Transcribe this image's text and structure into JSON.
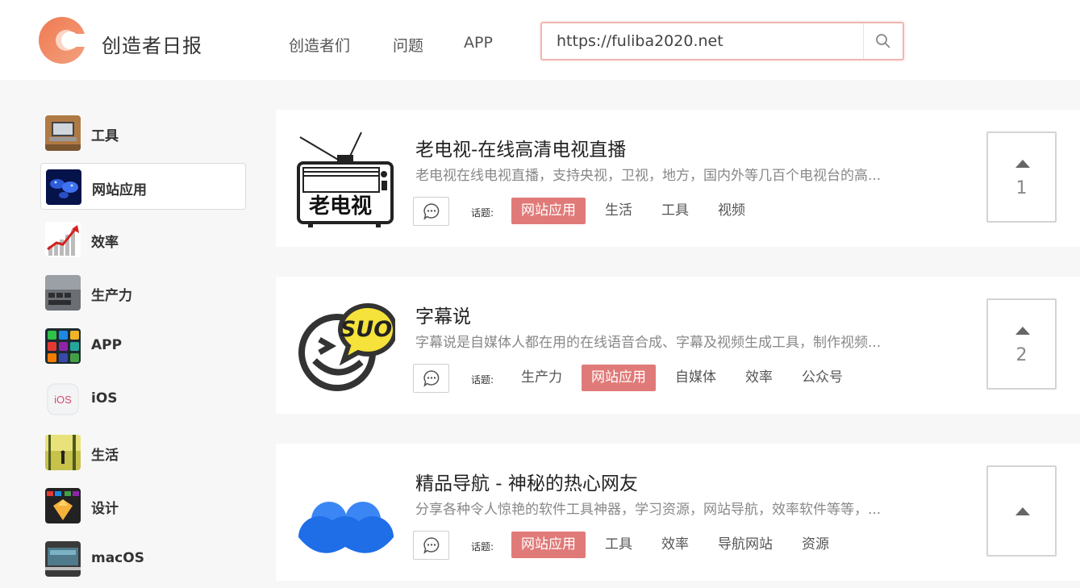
{
  "header": {
    "brand": "创造者日报",
    "nav": [
      "创造者们",
      "问题",
      "APP"
    ],
    "search_value": "https://fuliba2020.net",
    "logo_icon": "c-logo-icon",
    "accent_color": "#e07a78"
  },
  "sidebar": {
    "items": [
      {
        "label": "工具",
        "icon": "laptop-desk-icon"
      },
      {
        "label": "网站应用",
        "icon": "world-map-icon",
        "active": true
      },
      {
        "label": "效率",
        "icon": "growth-chart-icon"
      },
      {
        "label": "生产力",
        "icon": "keyboard-icon"
      },
      {
        "label": "APP",
        "icon": "app-grid-icon"
      },
      {
        "label": "iOS",
        "icon": "ios-icon"
      },
      {
        "label": "生活",
        "icon": "forest-walk-icon"
      },
      {
        "label": "设计",
        "icon": "sketch-icon"
      },
      {
        "label": "macOS",
        "icon": "macbook-icon"
      }
    ]
  },
  "topic_label": "话题:",
  "cards": [
    {
      "title": "老电视-在线高清电视直播",
      "description": "老电视在线电视直播，支持央视，卫视，地方，国内外等几百个电视台的高...",
      "thumb_text": "老电视",
      "tags": [
        "网站应用",
        "生活",
        "工具",
        "视频"
      ],
      "hot_tag": 0,
      "votes": "1"
    },
    {
      "title": "字幕说",
      "description": "字幕说是自媒体人都在用的在线语音合成、字幕及视频生成工具，制作视频...",
      "thumb_text": "SUO",
      "tags": [
        "生产力",
        "网站应用",
        "自媒体",
        "效率",
        "公众号"
      ],
      "hot_tag": 1,
      "votes": "2"
    },
    {
      "title": "精品导航 - 神秘的热心网友",
      "description": "分享各种令人惊艳的软件工具神器，学习资源，网站导航，效率软件等等，...",
      "thumb_text": "",
      "tags": [
        "网站应用",
        "工具",
        "效率",
        "导航网站",
        "资源"
      ],
      "hot_tag": 0,
      "votes": ""
    }
  ]
}
